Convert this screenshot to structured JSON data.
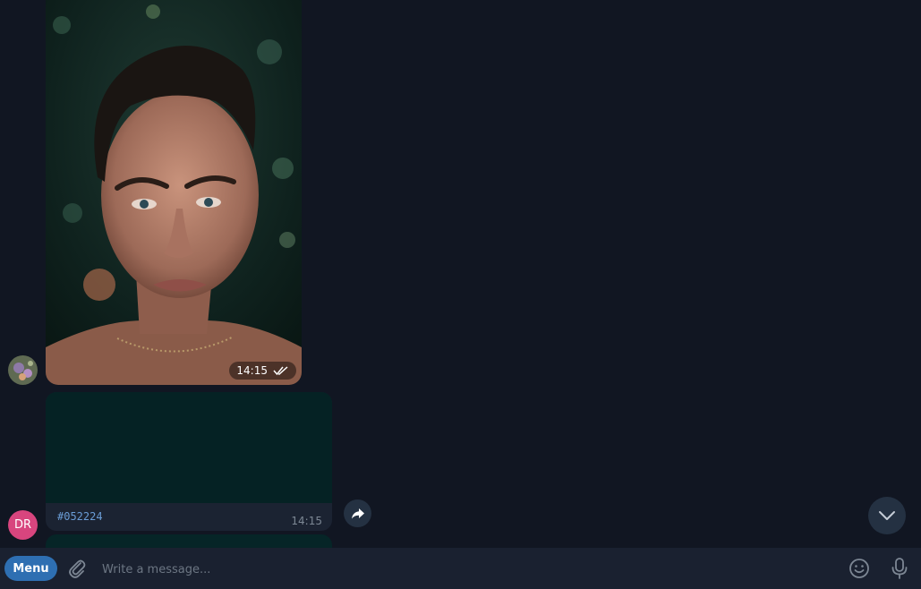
{
  "messages": {
    "photo": {
      "time": "14:15",
      "read_status_icon": "double-check-icon"
    },
    "color": {
      "hex": "#052224",
      "time": "14:15",
      "swatch_color": "#052224"
    }
  },
  "avatars": {
    "dr_initials": "DR",
    "dr_color": "#d8457e"
  },
  "composer": {
    "menu_label": "Menu",
    "placeholder": "Write a message..."
  },
  "colors": {
    "background": "#111622",
    "composer_bg": "#1a2130",
    "accent": "#2e6fb2"
  },
  "icons": {
    "share": "share-icon",
    "scroll_down": "chevron-down-icon",
    "attach": "paperclip-icon",
    "emoji": "emoji-icon",
    "mic": "microphone-icon"
  }
}
